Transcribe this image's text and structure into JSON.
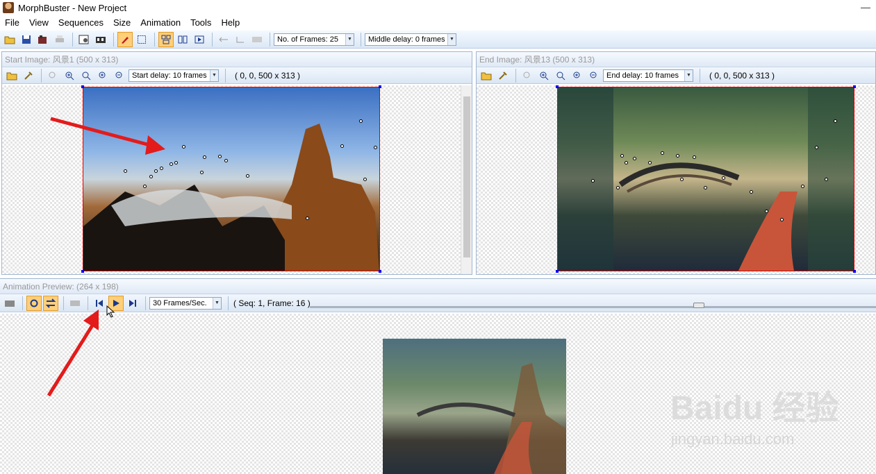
{
  "window": {
    "title": "MorphBuster - New Project",
    "minimize": "—"
  },
  "menu": [
    "File",
    "View",
    "Sequences",
    "Size",
    "Animation",
    "Tools",
    "Help"
  ],
  "toolbar": {
    "frames_combo": "No. of Frames: 25",
    "delay_combo": "Middle delay: 0 frames"
  },
  "start_pane": {
    "title": "Start Image: 风景1 (500 x 313)",
    "delay_combo": "Start delay: 10 frames",
    "coords": "( 0, 0, 500 x 313 )"
  },
  "end_pane": {
    "title": "End Image: 风景13 (500 x 313)",
    "delay_combo": "End delay: 10 frames",
    "coords": "( 0, 0, 500 x 313 )"
  },
  "preview_pane": {
    "title": "Animation Preview:  (264 x 198)",
    "fps_combo": "30 Frames/Sec.",
    "status": "( Seq: 1, Frame: 16 )"
  },
  "watermark": {
    "brand": "Baidu 经验",
    "url": "jingyan.baidu.com"
  },
  "colors": {
    "accent": "#ffcf7a",
    "arrow": "#e31b1b",
    "frame": "#dd0000",
    "handle": "#0000ff"
  },
  "icons": [
    "open-folder-icon",
    "save-icon",
    "export-icon",
    "print-icon",
    "properties-icon",
    "movie-icon",
    "pen-icon",
    "select-rect-icon",
    "layout-icon",
    "split-icon",
    "play-frame-icon",
    "undo-icon",
    "redo-icon",
    "zoom-in-icon",
    "zoom-out-icon",
    "fit-icon",
    "skip-start-icon",
    "play-icon",
    "skip-end-icon",
    "loop-icon",
    "swap-icon"
  ]
}
